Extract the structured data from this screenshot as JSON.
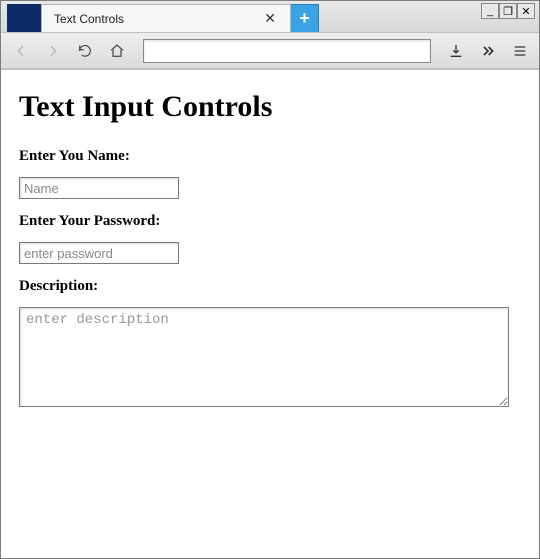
{
  "window": {
    "minimize": "_",
    "maximize": "❐",
    "close": "✕"
  },
  "tab": {
    "title": "Text Controls",
    "close": "✕",
    "newtab": "+"
  },
  "toolbar": {
    "url": ""
  },
  "page": {
    "heading": "Text Input Controls",
    "name_label": "Enter You Name:",
    "name_placeholder": "Name",
    "name_value": "",
    "password_label": "Enter Your Password:",
    "password_placeholder": "enter password",
    "password_value": "",
    "description_label": "Description:",
    "description_placeholder": "enter description",
    "description_value": ""
  }
}
